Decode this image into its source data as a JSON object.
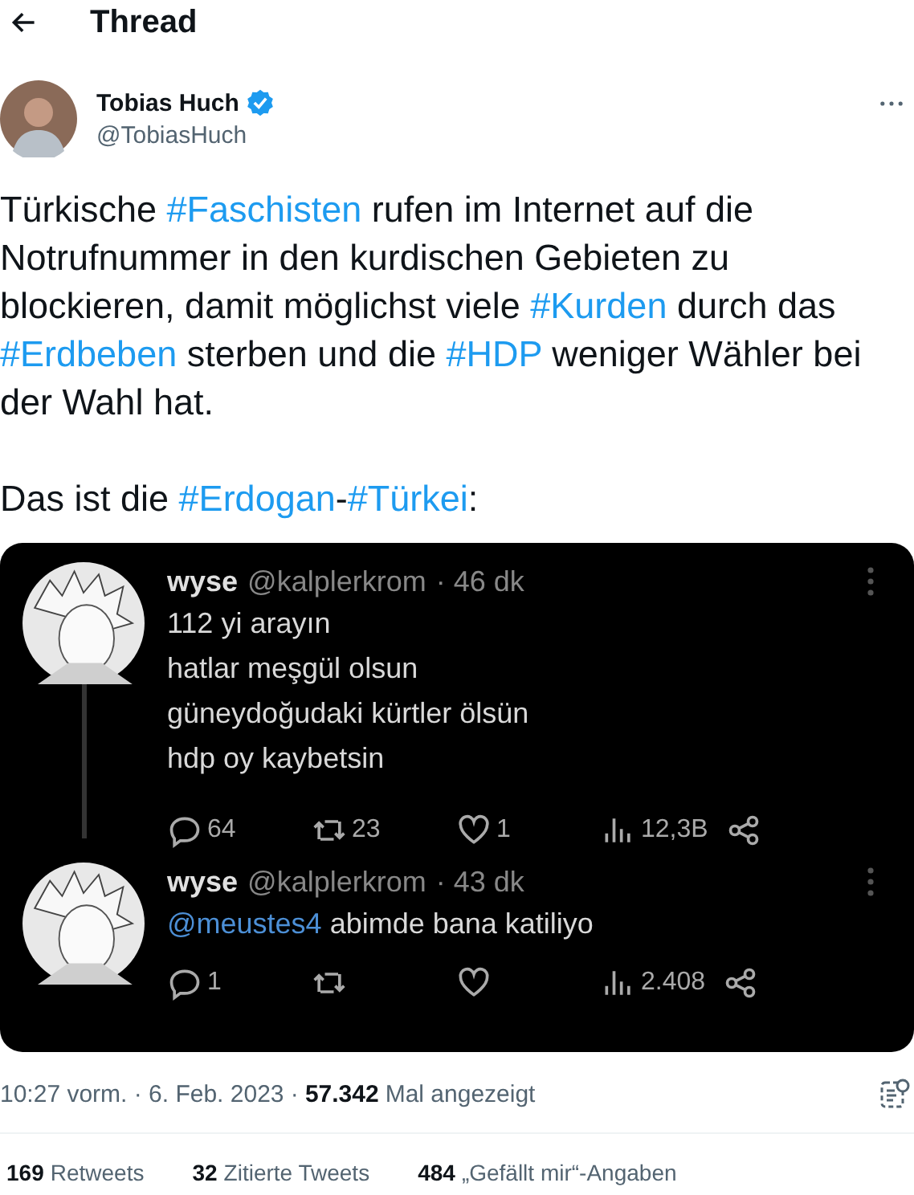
{
  "header": {
    "title": "Thread"
  },
  "author": {
    "name": "Tobias Huch",
    "handle": "@TobiasHuch",
    "verified": true
  },
  "tweet_text": [
    [
      {
        "kind": "plain",
        "text": "Türkische "
      },
      {
        "kind": "hashtag",
        "text": "#Faschisten"
      },
      {
        "kind": "plain",
        "text": " rufen im Internet auf die Notrufnummer in den kurdischen Gebieten zu blockieren, damit möglichst viele "
      },
      {
        "kind": "hashtag",
        "text": "#Kurden"
      },
      {
        "kind": "plain",
        "text": " durch das "
      },
      {
        "kind": "hashtag",
        "text": "#Erdbeben"
      },
      {
        "kind": "plain",
        "text": " sterben und die "
      },
      {
        "kind": "hashtag",
        "text": "#HDP"
      },
      {
        "kind": "plain",
        "text": " weniger Wähler bei der Wahl hat."
      }
    ],
    [
      {
        "kind": "plain",
        "text": "Das ist die "
      },
      {
        "kind": "hashtag",
        "text": "#Erdogan"
      },
      {
        "kind": "plain",
        "text": "-"
      },
      {
        "kind": "hashtag",
        "text": "#Türkei"
      },
      {
        "kind": "plain",
        "text": ":"
      }
    ]
  ],
  "embedded_screenshot": {
    "posts": [
      {
        "name": "wyse",
        "handle": "@kalplerkrom",
        "time": "· 46 dk",
        "thread_line": true,
        "lines": [
          [
            {
              "kind": "plain",
              "text": "112 yi arayın"
            }
          ],
          [
            {
              "kind": "plain",
              "text": "hatlar meşgül olsun"
            }
          ],
          [
            {
              "kind": "plain",
              "text": "güneydoğudaki kürtler ölsün"
            }
          ],
          [
            {
              "kind": "plain",
              "text": "hdp oy kaybetsin"
            }
          ]
        ],
        "replies": "64",
        "retweets": "23",
        "likes": "1",
        "views": "12,3B"
      },
      {
        "name": "wyse",
        "handle": "@kalplerkrom",
        "time": "· 43 dk",
        "thread_line": false,
        "lines": [
          [
            {
              "kind": "mention",
              "text": "@meustes4"
            },
            {
              "kind": "plain",
              "text": " abimde bana katiliyo"
            }
          ]
        ],
        "replies": "1",
        "views": "2.408"
      }
    ]
  },
  "meta": {
    "timestamp": "10:27 vorm. · 6. Feb. 2023 ·",
    "views": "57.342",
    "views_label": "Mal angezeigt"
  },
  "counts": [
    {
      "value": "169",
      "label": "Retweets"
    },
    {
      "value": "32",
      "label": "Zitierte Tweets"
    },
    {
      "value": "484",
      "label": "„Gefällt mir“-Angaben"
    }
  ]
}
